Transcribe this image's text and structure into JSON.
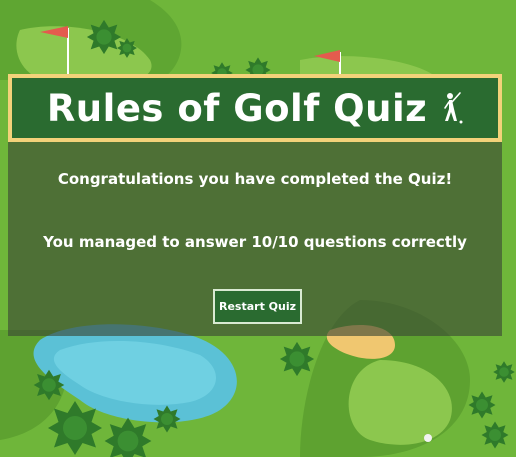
{
  "header": {
    "title": "Rules of Golf Quiz",
    "icon": "golfer-icon"
  },
  "result": {
    "congrats_text": "Congratulations you have completed the Quiz!",
    "score_text": "You managed to answer 10/10 questions correctly"
  },
  "actions": {
    "restart_label": "Restart Quiz"
  },
  "colors": {
    "header_bg": "#2a6b30",
    "header_border": "#f3d27a",
    "grass": "#6fb63a"
  }
}
